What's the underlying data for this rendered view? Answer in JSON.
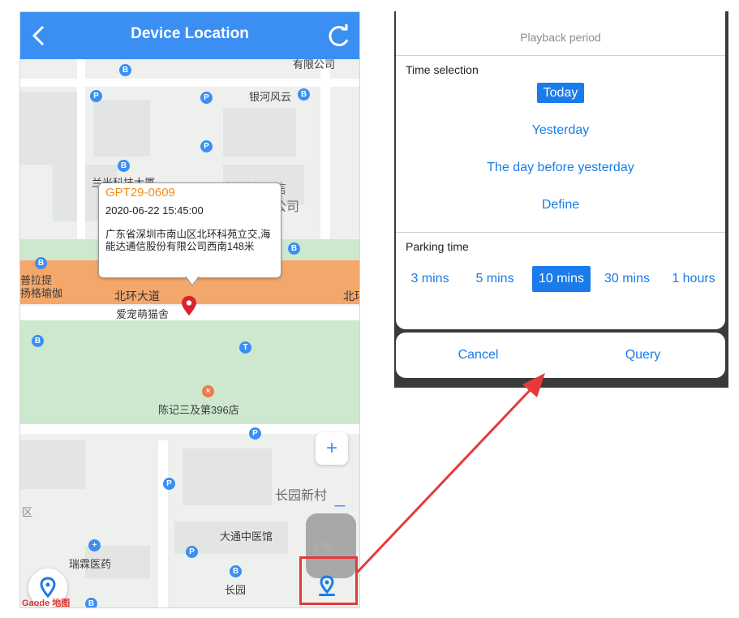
{
  "phone": {
    "title": "Device Location",
    "map_labels": {
      "company_top": "有限公司",
      "yinhe": "银河风云",
      "lanfeng": "兰光科技大厦",
      "haineng": "海能达通信",
      "gongsi": "公司",
      "pula": "普拉提",
      "yangge": "扬格瑜伽",
      "beihuan": "北环大道",
      "beihuan_right": "北环",
      "aichong": "爱宠萌猫舍",
      "chenji": "陈记三及第396店",
      "changyuan": "长园新村",
      "datong": "大通中医馆",
      "ruilin": "瑞霖医药",
      "changyuan_small": "长园",
      "fdong": "F栋",
      "qu": "区",
      "map_brand": "Gaode 地图"
    },
    "device": {
      "name": "GPT29-0609",
      "time": "2020-06-22 15:45:00",
      "address": "广东省深圳市南山区北环科苑立交,海能达通信股份有限公司西南148米"
    },
    "zoom_in": "+",
    "zoom_out": "_"
  },
  "dialog": {
    "title": "Playback period",
    "time_selection_label": "Time selection",
    "time_options": [
      "Today",
      "Yesterday",
      "The day before yesterday",
      "Define"
    ],
    "selected_time": "Today",
    "parking_label": "Parking time",
    "parking_options": [
      "3 mins",
      "5 mins",
      "10 mins",
      "30 mins",
      "1 hours"
    ],
    "selected_parking": "10 mins",
    "cancel": "Cancel",
    "query": "Query"
  },
  "colors": {
    "accent": "#1a7bea",
    "header": "#3b8ff2",
    "device_name": "#f08c1a",
    "highlight": "#e43a3a",
    "road_main": "#f4a76a",
    "park": "#cde8cf"
  }
}
